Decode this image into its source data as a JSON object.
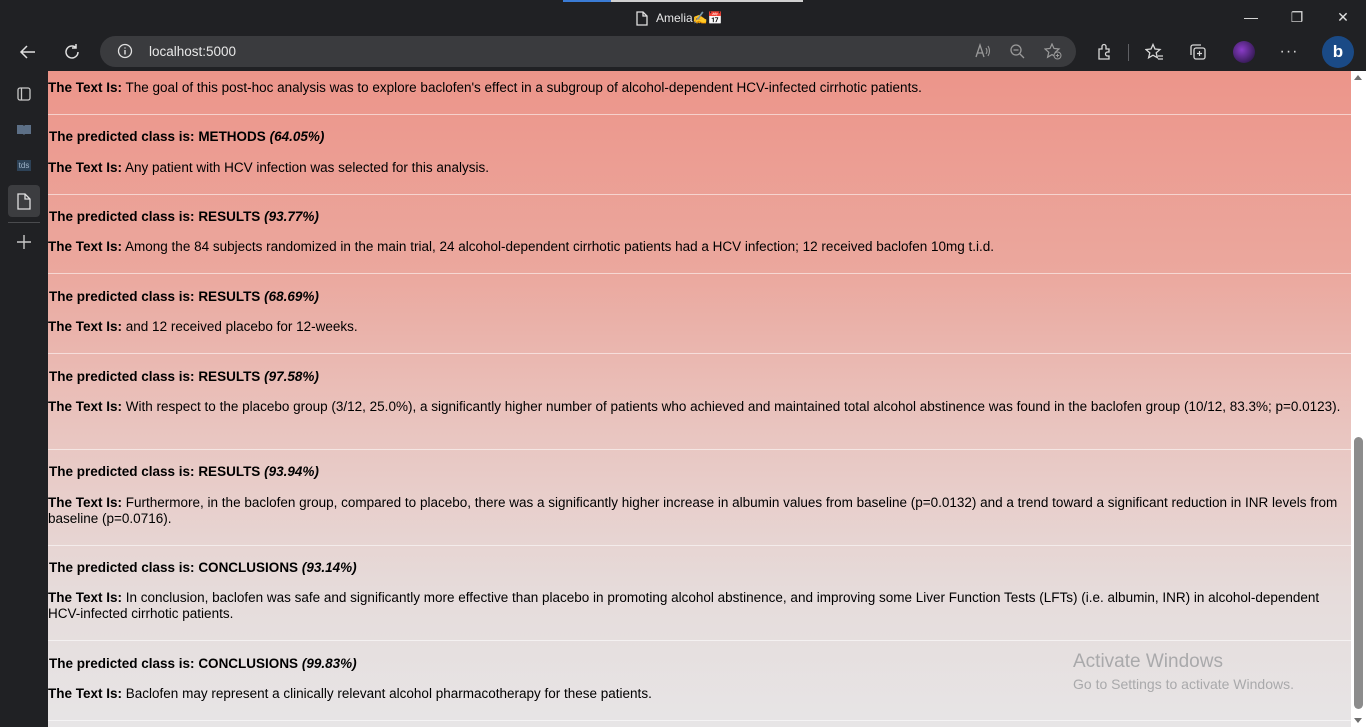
{
  "window": {
    "tab_title": "Amelia✍️📅",
    "controls": {
      "minimize": "—",
      "restore": "❐",
      "close": "✕"
    }
  },
  "toolbar": {
    "url": "localhost:5000",
    "icons": [
      "back-icon",
      "refresh-icon",
      "info-icon",
      "read-aloud-icon",
      "zoom-out-icon",
      "add-favorite-icon",
      "extensions-icon",
      "favorites-icon",
      "collections-icon",
      "profile-avatar",
      "more-icon",
      "bing-icon"
    ]
  },
  "sidebar": {
    "items": [
      {
        "name": "tab-actions-icon",
        "label": ""
      },
      {
        "name": "book-tab-icon",
        "label": ""
      },
      {
        "name": "tds-tab-icon",
        "label": "tds"
      },
      {
        "name": "page-tab-icon",
        "label": ""
      },
      {
        "name": "new-tab-icon",
        "label": ""
      }
    ]
  },
  "results": {
    "class_prefix": "The predicted class is: ",
    "text_prefix": "The Text Is:",
    "first_text": "The goal of this post-hoc analysis was to explore baclofen's effect in a subgroup of alcohol-dependent HCV-infected cirrhotic patients.",
    "entries": [
      {
        "cls": "METHODS",
        "pct": "(64.05%)",
        "text": "Any patient with HCV infection was selected for this analysis."
      },
      {
        "cls": "RESULTS",
        "pct": "(93.77%)",
        "text": "Among the 84 subjects randomized in the main trial, 24 alcohol-dependent cirrhotic patients had a HCV infection; 12 received baclofen 10mg t.i.d."
      },
      {
        "cls": "RESULTS",
        "pct": "(68.69%)",
        "text": "and 12 received placebo for 12-weeks."
      },
      {
        "cls": "RESULTS",
        "pct": "(97.58%)",
        "text": "With respect to the placebo group (3/12, 25.0%), a significantly higher number of patients who achieved and maintained total alcohol abstinence was found in the baclofen group (10/12, 83.3%; p=0.0123)."
      },
      {
        "cls": "RESULTS",
        "pct": "(93.94%)",
        "text": "Furthermore, in the baclofen group, compared to placebo, there was a significantly higher increase in albumin values from baseline (p=0.0132) and a trend toward a significant reduction in INR levels from baseline (p=0.0716)."
      },
      {
        "cls": "CONCLUSIONS",
        "pct": "(93.14%)",
        "text": "In conclusion, baclofen was safe and significantly more effective than placebo in promoting alcohol abstinence, and improving some Liver Function Tests (LFTs) (i.e. albumin, INR) in alcohol-dependent HCV-infected cirrhotic patients."
      },
      {
        "cls": "CONCLUSIONS",
        "pct": "(99.83%)",
        "text": "Baclofen may represent a clinically relevant alcohol pharmacotherapy for these patients."
      }
    ]
  },
  "watermark": {
    "line1": "Activate Windows",
    "line2": "Go to Settings to activate Windows."
  }
}
